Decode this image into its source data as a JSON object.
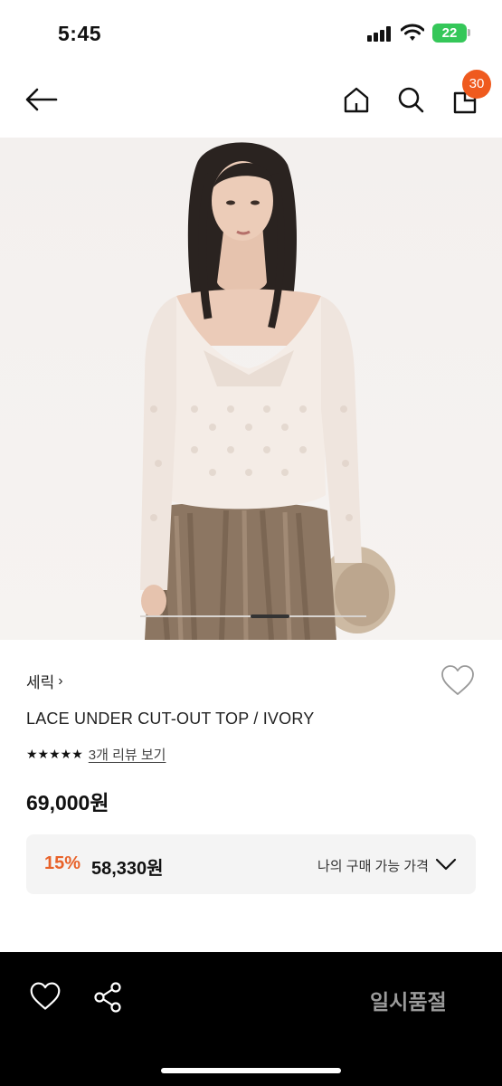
{
  "status_bar": {
    "time": "5:45",
    "battery": "22",
    "icons": [
      "signal-icon",
      "wifi-icon",
      "battery-icon"
    ]
  },
  "nav": {
    "icons": [
      "back-arrow-icon",
      "home-icon",
      "search-icon",
      "shopping-bag-icon"
    ],
    "cart_count": "30",
    "accent_color": "#ef5a1e"
  },
  "gallery": {
    "image": "product-photo"
  },
  "product": {
    "brand": "세릭",
    "brand_chevron": "›",
    "name": "LACE UNDER CUT-OUT TOP / IVORY",
    "stars": "★★★★★",
    "review_link": "3개 리뷰 보기",
    "price": "69,000원",
    "member_price": {
      "discount_rate": "15%",
      "discount_price": "58,330원",
      "label": "나의 구매 가능 가격",
      "discount_color": "#e8622a"
    }
  },
  "bottom_bar": {
    "icons": [
      "heart-icon",
      "share-icon"
    ],
    "status_label": "일시품절"
  }
}
